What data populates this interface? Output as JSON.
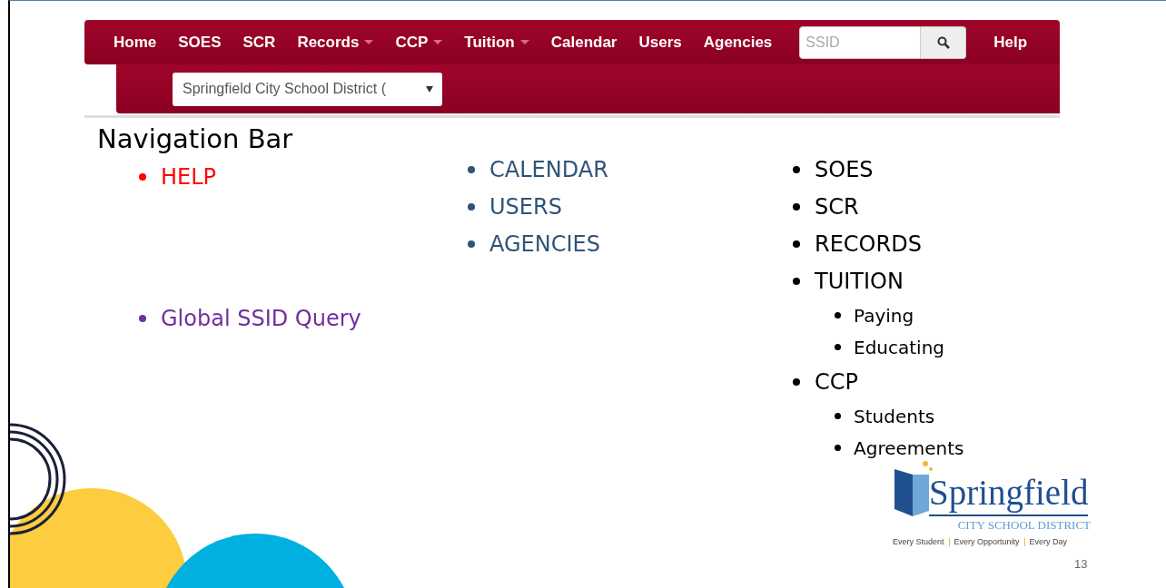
{
  "navbar": {
    "items": [
      {
        "label": "Home",
        "caret": false
      },
      {
        "label": "SOES",
        "caret": false
      },
      {
        "label": "SCR",
        "caret": false
      },
      {
        "label": "Records",
        "caret": true
      },
      {
        "label": "CCP",
        "caret": true
      },
      {
        "label": "Tuition",
        "caret": true
      },
      {
        "label": "Calendar",
        "caret": false
      },
      {
        "label": "Users",
        "caret": false
      },
      {
        "label": "Agencies",
        "caret": false
      }
    ],
    "search": {
      "placeholder": "SSID"
    },
    "help": "Help",
    "district_select": {
      "value": "Springfield City School District ("
    }
  },
  "slide": {
    "title": "Navigation Bar",
    "columns": [
      {
        "items": [
          {
            "text": "HELP",
            "color": "#ff0000"
          },
          {
            "text": "Global SSID Query",
            "color": "#7030a0"
          }
        ]
      },
      {
        "items": [
          {
            "text": "CALENDAR",
            "color": "#2f5479"
          },
          {
            "text": "USERS",
            "color": "#2f5479"
          },
          {
            "text": "AGENCIES",
            "color": "#2f5479"
          }
        ]
      },
      {
        "items": [
          {
            "text": "SOES",
            "color": "#000000"
          },
          {
            "text": "SCR",
            "color": "#000000"
          },
          {
            "text": "RECORDS",
            "color": "#000000"
          },
          {
            "text": "TUITION",
            "color": "#000000",
            "children": [
              {
                "text": "Paying"
              },
              {
                "text": "Educating"
              }
            ]
          },
          {
            "text": "CCP",
            "color": "#000000",
            "children": [
              {
                "text": "Students"
              },
              {
                "text": "Agreements"
              }
            ]
          }
        ]
      }
    ],
    "logo": {
      "name": "Springfield",
      "subtitle": "CITY SCHOOL DISTRICT",
      "mottos": [
        "Every Student",
        "Every Opportunity",
        "Every Day"
      ]
    },
    "page_number": "13"
  }
}
